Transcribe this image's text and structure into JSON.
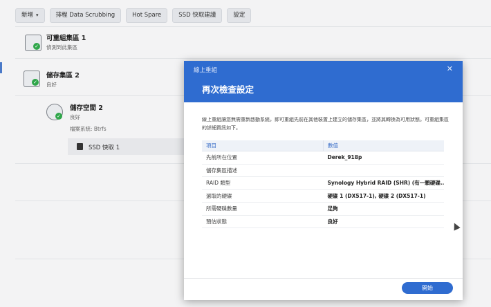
{
  "toolbar": {
    "create": "新增",
    "data_scrubbing": "排程 Data Scrubbing",
    "hot_spare": "Hot Spare",
    "ssd_cache_advisor": "SSD 快取建議",
    "settings": "設定"
  },
  "items": {
    "available_pool": {
      "title": "可重組集區 1",
      "sub": "偵測到此集區"
    },
    "storage_pool": {
      "title": "儲存集區 2",
      "sub": "良好"
    },
    "volume": {
      "title": "儲存空間 2",
      "status": "良好",
      "fs": "檔案系統: Btrfs"
    },
    "ssd_cache": {
      "label": "SSD 快取 1"
    }
  },
  "dialog": {
    "window_title": "線上重組",
    "heading": "再次檢查設定",
    "description": "線上重組讓您無需重新啟動系統，即可重組先前在其他裝置上建立的儲存集區，並將其轉換為可用狀態。可重組集區的詳細資訊如下。",
    "table": {
      "headers": [
        "項目",
        "數值"
      ],
      "rows": [
        {
          "key": "先前所在位置",
          "value": "Derek_918p"
        },
        {
          "key": "儲存集區描述",
          "value": ""
        },
        {
          "key": "RAID 類型",
          "value": "Synology Hybrid RAID (SHR) (有一顆硬碟..."
        },
        {
          "key": "選取的硬碟",
          "value": "硬碟 1 (DX517-1), 硬碟 2 (DX517-1)"
        },
        {
          "key": "所需硬碟數量",
          "value": "足夠"
        },
        {
          "key": "預估狀態",
          "value": "良好"
        }
      ]
    },
    "apply_button": "開始"
  },
  "colors": {
    "accent": "#2f6cd0",
    "ok": "#2fa64a"
  }
}
